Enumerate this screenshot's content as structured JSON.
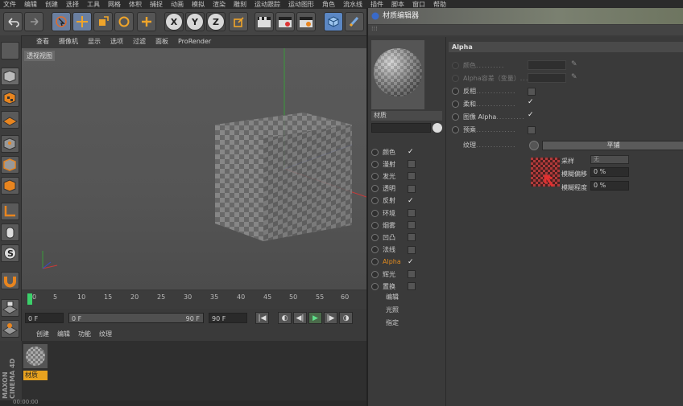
{
  "menubar": [
    "文件",
    "编辑",
    "创建",
    "选择",
    "工具",
    "网格",
    "体积",
    "捕捉",
    "动画",
    "模拟",
    "渲染",
    "雕刻",
    "运动跟踪",
    "运动图形",
    "角色",
    "流水线",
    "插件",
    "脚本",
    "窗口",
    "帮助"
  ],
  "toolbar": {
    "axes": [
      "X",
      "Y",
      "Z"
    ]
  },
  "viewport": {
    "menu": [
      "查看",
      "摄像机",
      "显示",
      "选项",
      "过滤",
      "面板",
      "ProRender"
    ],
    "label": "透视视图"
  },
  "timeline": {
    "ticks": [
      "0",
      "5",
      "10",
      "15",
      "20",
      "25",
      "30",
      "35",
      "40",
      "45",
      "50",
      "55",
      "60"
    ]
  },
  "transport": {
    "start": "0 F",
    "current": "0 F",
    "end_inner": "90 F",
    "end": "90 F"
  },
  "material_manager": {
    "menu": [
      "创建",
      "编辑",
      "功能",
      "纹理"
    ],
    "material_name": "材质",
    "brand": "MAXON CINEMA 4D"
  },
  "status": {
    "time": "00:00:00"
  },
  "editor": {
    "title": "材质编辑器",
    "material_name": "材质",
    "channels": [
      {
        "label": "颜色",
        "checked": true
      },
      {
        "label": "漫射",
        "checked": false
      },
      {
        "label": "发光",
        "checked": false
      },
      {
        "label": "透明",
        "checked": false
      },
      {
        "label": "反射",
        "checked": true
      },
      {
        "label": "环境",
        "checked": false
      },
      {
        "label": "烟雾",
        "checked": false
      },
      {
        "label": "凹凸",
        "checked": false
      },
      {
        "label": "法线",
        "checked": false
      },
      {
        "label": "Alpha",
        "checked": true
      },
      {
        "label": "辉光",
        "checked": false
      },
      {
        "label": "置换",
        "checked": false
      }
    ],
    "extra_items": [
      "编辑",
      "光照",
      "指定"
    ],
    "section_title": "Alpha",
    "props": [
      {
        "label": "颜色",
        "dots": "..........",
        "checked": null,
        "disabled": true
      },
      {
        "label": "Alpha容差（变量）",
        "dots": "...",
        "checked": null,
        "disabled": true
      },
      {
        "label": "反相",
        "dots": "..............",
        "checked": false
      },
      {
        "label": "柔和",
        "dots": "..............",
        "checked": true
      },
      {
        "label": "图像 Alpha",
        "dots": "..........",
        "checked": true
      },
      {
        "label": "预乘",
        "dots": "..............",
        "checked": false
      }
    ],
    "texture_label": "纹理",
    "texture_dots": "..............",
    "texture_mode": "平铺",
    "sampling_label": "采样",
    "sampling_value": "无",
    "blur_offset_label": "模糊偏移",
    "blur_offset_value": "0 %",
    "blur_amount_label": "模糊程度",
    "blur_amount_value": "0 %",
    "accent": "#e08a1e"
  }
}
